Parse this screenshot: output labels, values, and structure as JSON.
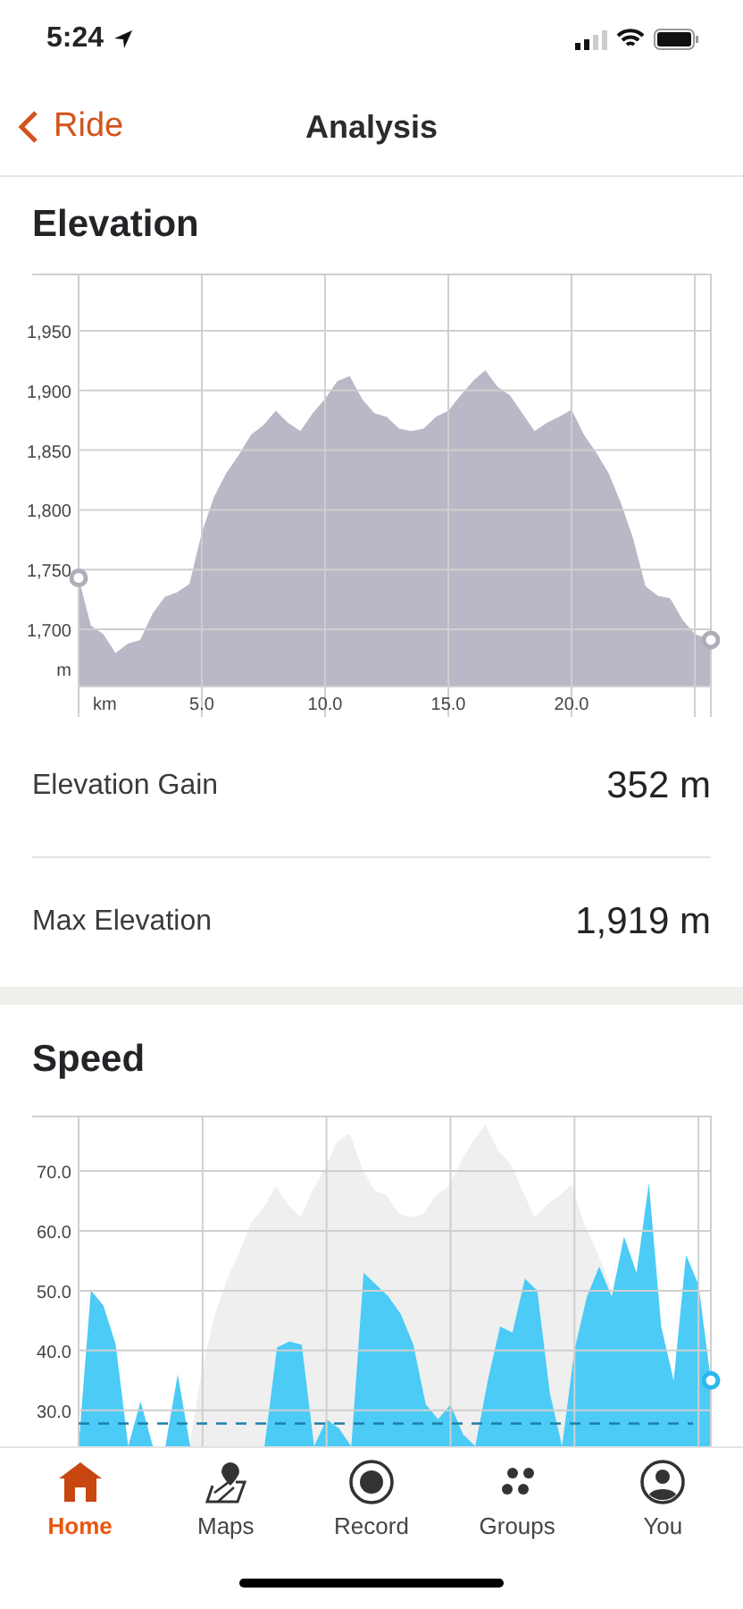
{
  "status_bar": {
    "time": "5:24"
  },
  "nav": {
    "back_label": "Ride",
    "title": "Analysis"
  },
  "sections": [
    {
      "kind": "elevation",
      "title": "Elevation",
      "chart_data": {
        "type": "area",
        "xlabel": "km",
        "ylabel": "m",
        "x": [
          0,
          0.5,
          1,
          1.5,
          2,
          2.5,
          3,
          3.5,
          4,
          4.5,
          5,
          5.5,
          6,
          6.5,
          7,
          7.5,
          8,
          8.5,
          9,
          9.5,
          10,
          10.5,
          11,
          11.5,
          12,
          12.5,
          13,
          13.5,
          14,
          14.5,
          15,
          15.5,
          16,
          16.5,
          17,
          17.5,
          18,
          18.5,
          19,
          19.5,
          20,
          20.5,
          21,
          21.5,
          22,
          22.5,
          23,
          23.5,
          24,
          24.5,
          25,
          25.65
        ],
        "grid": true,
        "series": [
          {
            "color": "#b9b8c6",
            "values": [
              1743,
              1703,
              1696,
              1680,
              1688,
              1691,
              1713,
              1727,
              1731,
              1738,
              1781,
              1811,
              1831,
              1846,
              1863,
              1871,
              1883,
              1873,
              1866,
              1881,
              1893,
              1908,
              1912,
              1893,
              1881,
              1878,
              1868,
              1866,
              1868,
              1878,
              1883,
              1896,
              1908,
              1917,
              1903,
              1896,
              1881,
              1866,
              1873,
              1878,
              1884,
              1863,
              1848,
              1831,
              1806,
              1776,
              1736,
              1728,
              1726,
              1708,
              1696,
              1691
            ]
          }
        ],
        "xlim": [
          0,
          25.65
        ],
        "ylim": [
          1652,
          1998
        ],
        "xticks": [
          {
            "value": 5,
            "label": "5.0"
          },
          {
            "value": 10,
            "label": "10.0"
          },
          {
            "value": 15,
            "label": "15.0"
          },
          {
            "value": 20,
            "label": "20.0"
          }
        ],
        "yticks": [
          {
            "value": 1700,
            "label": "1,700"
          },
          {
            "value": 1750,
            "label": "1,750"
          },
          {
            "value": 1800,
            "label": "1,800"
          },
          {
            "value": 1850,
            "label": "1,850"
          },
          {
            "value": 1900,
            "label": "1,900"
          },
          {
            "value": 1950,
            "label": "1,950"
          }
        ]
      },
      "stats": [
        {
          "label": "Elevation Gain",
          "value": "352 m"
        },
        {
          "label": "Max Elevation",
          "value": "1,919 m"
        }
      ]
    },
    {
      "kind": "speed",
      "title": "Speed",
      "chart_data": {
        "type": "area",
        "grid": true,
        "series": [
          {
            "color": "#41c8f6",
            "values": [
              24,
              50,
              47.5,
              41,
              null,
              31.5,
              null,
              null,
              36,
              null,
              null,
              null,
              null,
              null,
              null,
              null,
              40.5,
              41.5,
              41,
              null,
              28.5,
              27,
              null,
              53,
              51,
              49,
              46,
              41,
              31,
              28.5,
              31,
              26,
              null,
              35,
              44,
              43,
              52,
              50,
              33,
              null,
              40,
              49,
              54,
              49,
              59,
              53,
              68,
              44,
              35,
              56,
              51,
              35
            ]
          }
        ],
        "ylim": [
          24,
          79.25
        ],
        "yticks": [
          {
            "value": 30,
            "label": "30.0"
          },
          {
            "value": 40,
            "label": "40.0"
          },
          {
            "value": 50,
            "label": "50.0"
          },
          {
            "value": 60,
            "label": "60.0"
          },
          {
            "value": 70,
            "label": "70.0"
          }
        ],
        "ref_lines": [
          {
            "axis": "y",
            "value": 27.8
          }
        ]
      }
    }
  ],
  "tab_bar": [
    {
      "label": "Home",
      "selected": true
    },
    {
      "label": "Maps",
      "selected": false
    },
    {
      "label": "Record",
      "selected": false
    },
    {
      "label": "Groups",
      "selected": false
    },
    {
      "label": "You",
      "selected": false
    }
  ]
}
